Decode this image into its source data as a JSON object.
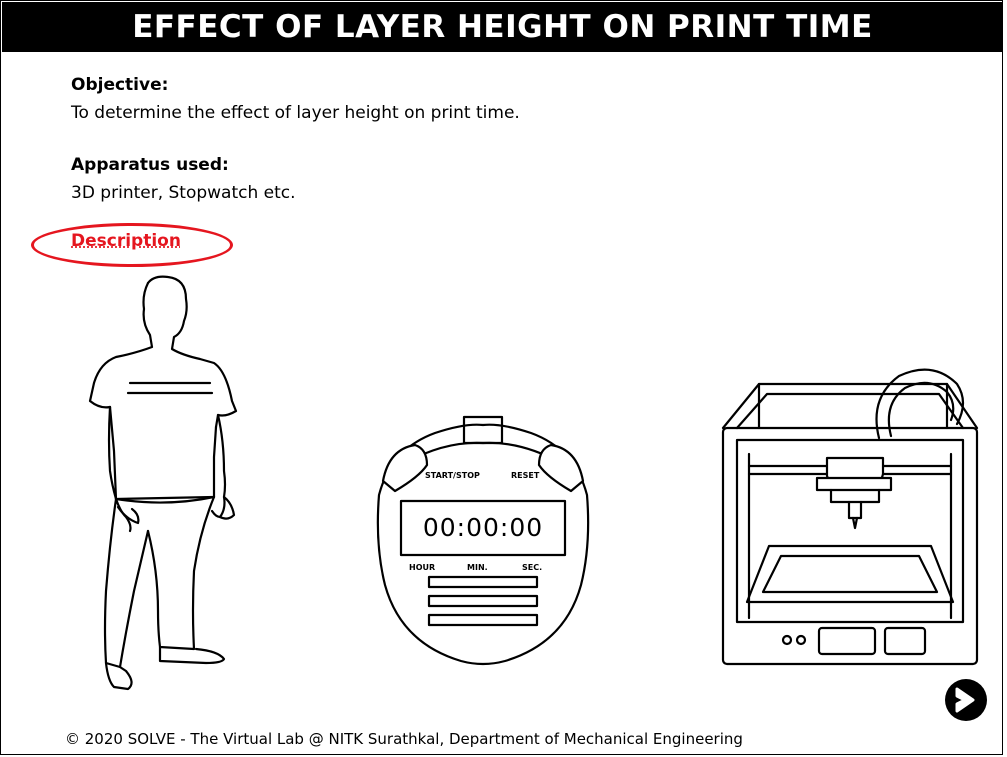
{
  "title": "EFFECT OF LAYER HEIGHT ON PRINT TIME",
  "objective": {
    "heading": "Objective:",
    "text": "To determine the effect of layer height on print time."
  },
  "apparatus": {
    "heading": "Apparatus used:",
    "text": "3D printer, Stopwatch etc."
  },
  "description_link": "Description",
  "stopwatch": {
    "time": "00:00:00",
    "start_stop_label": "START/STOP",
    "reset_label": "RESET",
    "hour_label": "HOUR",
    "min_label": "MIN.",
    "sec_label": "SEC."
  },
  "next_icon": "arrow-right-icon",
  "footer": "© 2020 SOLVE - The Virtual Lab @ NITK Surathkal, Department of Mechanical Engineering",
  "colors": {
    "title_bg": "#000000",
    "title_text": "#ffffff",
    "description": "#e5161f"
  }
}
